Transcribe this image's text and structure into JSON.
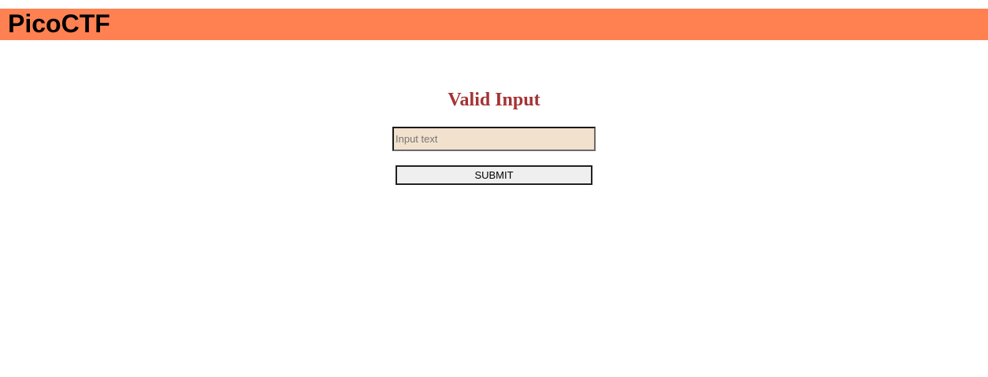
{
  "header": {
    "brand": "PicoCTF",
    "background_color": "#ff8152"
  },
  "main": {
    "title": "Valid Input",
    "title_color": "#a33434",
    "input": {
      "value": "",
      "placeholder": "Input text",
      "background_color": "#f2e1cd"
    },
    "submit_label": "SUBMIT"
  }
}
